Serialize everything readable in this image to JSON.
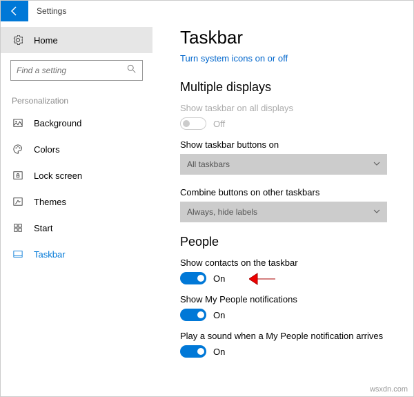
{
  "app_title": "Settings",
  "home_label": "Home",
  "search_placeholder": "Find a setting",
  "section_label": "Personalization",
  "nav": [
    {
      "label": "Background"
    },
    {
      "label": "Colors"
    },
    {
      "label": "Lock screen"
    },
    {
      "label": "Themes"
    },
    {
      "label": "Start"
    },
    {
      "label": "Taskbar"
    }
  ],
  "page_title": "Taskbar",
  "link_text": "Turn system icons on or off",
  "multiple_displays": {
    "heading": "Multiple displays",
    "show_all": {
      "label": "Show taskbar on all displays",
      "state": "Off"
    },
    "buttons_on": {
      "label": "Show taskbar buttons on",
      "value": "All taskbars"
    },
    "combine": {
      "label": "Combine buttons on other taskbars",
      "value": "Always, hide labels"
    }
  },
  "people": {
    "heading": "People",
    "contacts": {
      "label": "Show contacts on the taskbar",
      "state": "On"
    },
    "notifications": {
      "label": "Show My People notifications",
      "state": "On"
    },
    "sound": {
      "label": "Play a sound when a My People notification arrives",
      "state": "On"
    }
  },
  "watermark": "wsxdn.com"
}
